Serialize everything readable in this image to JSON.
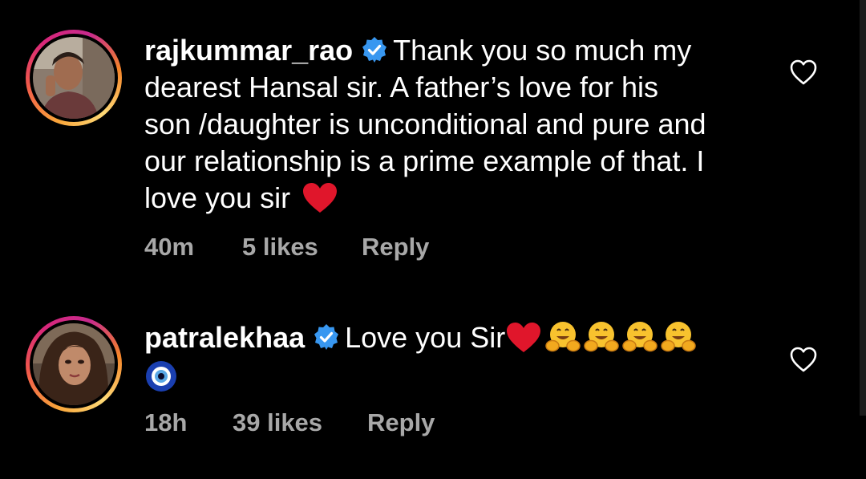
{
  "comments": [
    {
      "username": "rajkummar_rao",
      "verified": true,
      "text_lines": [
        "Thank you so much my",
        "dearest Hansal sir. A father’s love for his",
        "son /daughter is unconditional and pure and",
        "our relationship is a prime example of that. I",
        "love you sir"
      ],
      "emoji": [
        "red-heart"
      ],
      "time": "40m",
      "likes": "5 likes",
      "reply": "Reply"
    },
    {
      "username": "patralekhaa",
      "verified": true,
      "text": "Love you Sir",
      "emoji": [
        "red-heart",
        "hugging-face",
        "hugging-face",
        "hugging-face",
        "hugging-face",
        "nazar-amulet"
      ],
      "time": "18h",
      "likes": "39 likes",
      "reply": "Reply"
    }
  ],
  "colors": {
    "background": "#000000",
    "text": "#ffffff",
    "meta": "#a8a8a8",
    "verified": "#3897f0",
    "heart": "#e0162b"
  }
}
